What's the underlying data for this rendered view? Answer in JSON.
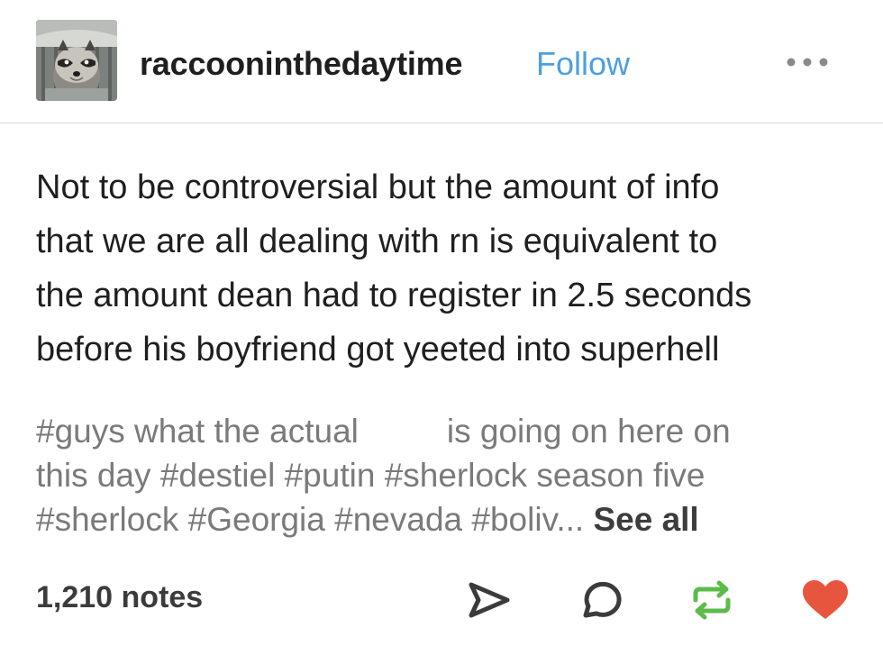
{
  "post": {
    "username": "raccooninthedaytime",
    "follow_label": "Follow",
    "body_lines": [
      "Not to be controversial but the amount of info",
      "that we are all dealing with rn is equivalent to",
      "the amount dean had to register in 2.5 seconds",
      "before his boyfriend got yeeted into superhell"
    ],
    "tags": {
      "line1_before": "#guys what the actual",
      "line1_after": "is going on here on",
      "line2_start": "this day",
      "line2_tags": [
        "#destiel",
        "#putin",
        "#sherlock season five"
      ],
      "line3_tags": [
        "#sherlock",
        "#Georgia",
        "#nevada",
        "#boliv..."
      ],
      "see_all_label": "See all"
    },
    "notes_count": "1,210 notes"
  },
  "icons": {
    "more": "more-options-icon",
    "share": "share-icon",
    "reply": "reply-icon",
    "reblog": "reblog-icon",
    "like": "heart-icon"
  },
  "colors": {
    "follow": "#4d9fde",
    "tags": "#7a7a7a",
    "reblog": "#5dbb4a",
    "heart": "#e8553f"
  }
}
